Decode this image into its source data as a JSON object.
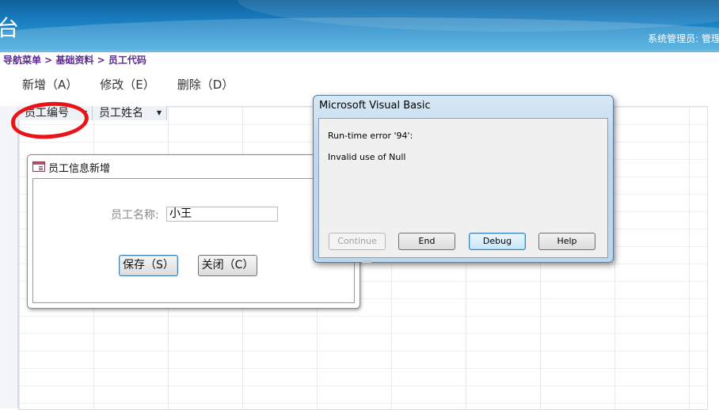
{
  "app": {
    "title_fragment": "台",
    "user_info": "系统管理员: 管理"
  },
  "breadcrumb": "导航菜单 > 基础资料 > 员工代码",
  "toolbar": {
    "add": "新增（A）",
    "edit": "修改（E）",
    "delete": "删除（D）"
  },
  "grid": {
    "columns": [
      {
        "label": "员工编号"
      },
      {
        "label": "员工姓名"
      }
    ],
    "dropdown_glyph": "▼"
  },
  "form": {
    "title": "员工信息新增",
    "name_label": "员工名称:",
    "name_value": "小王",
    "save_button": "保存（S）",
    "close_button": "关闭（C）"
  },
  "vb_dialog": {
    "title": "Microsoft Visual Basic",
    "error_line": "Run-time error '94':",
    "message": "Invalid use of Null",
    "buttons": {
      "continue": "Continue",
      "end": "End",
      "debug": "Debug",
      "help": "Help"
    }
  },
  "colors": {
    "header_blue": "#1a80c2",
    "breadcrumb": "#5a2c8e",
    "annotation_red": "#e8141a"
  }
}
